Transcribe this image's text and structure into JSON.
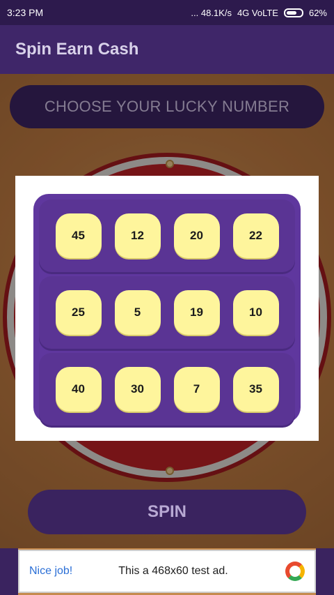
{
  "status_bar": {
    "time": "3:23 PM",
    "network_speed": "... 48.1K/s",
    "network": "4G VoLTE",
    "battery": "62%"
  },
  "app_bar": {
    "title": "Spin Earn Cash"
  },
  "choose_label": "CHOOSE YOUR LUCKY NUMBER",
  "numbers": [
    [
      "45",
      "12",
      "20",
      "22"
    ],
    [
      "25",
      "5",
      "19",
      "10"
    ],
    [
      "40",
      "30",
      "7",
      "35"
    ]
  ],
  "spin_label": "SPIN",
  "ad": {
    "left_text": "Nice job!",
    "right_text": "This a 468x60 test ad."
  }
}
